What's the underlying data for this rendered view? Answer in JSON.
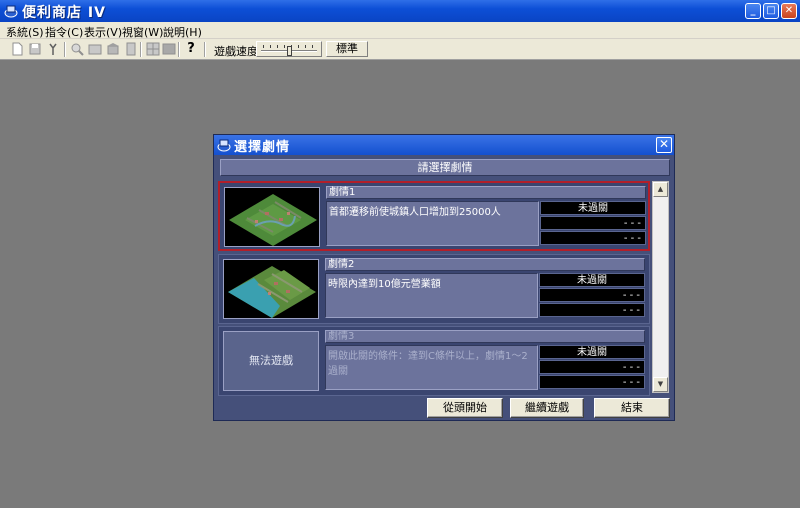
{
  "window": {
    "title": "便利商店 IV",
    "minimize_label": "_",
    "maximize_label": "□",
    "close_label": "✕"
  },
  "menu": [
    "系統(S)",
    "指令(C)",
    "表示(V)",
    "視窗(W)",
    "說明(H)"
  ],
  "toolbar": {
    "help_label": "?",
    "speed_label": "遊戲速度",
    "speed_value": "標準",
    "speed_level": 0.5
  },
  "dialog": {
    "title": "選擇劇情",
    "close_label": "✕",
    "prompt": "請選擇劇情",
    "scenarios": [
      {
        "title": "劇情1",
        "description": "首都遷移前使城鎮人口增加到25000人",
        "status": "未過關",
        "record1": "- - -",
        "record2": "- - -",
        "selected": true
      },
      {
        "title": "劇情2",
        "description": "時限內達到10億元營業額",
        "status": "未過關",
        "record1": "- - -",
        "record2": "- - -",
        "selected": false
      },
      {
        "title": "劇情3",
        "description": "開啟此關的條件：達到C條件以上，劇情1～2過關",
        "status": "未過關",
        "record1": "- - -",
        "record2": "- - -",
        "locked_label": "無法遊戲",
        "selected": false
      }
    ],
    "buttons": {
      "new_game": "從頭開始",
      "continue": "繼續遊戲",
      "exit": "結束"
    }
  },
  "colors": {
    "dialog_bg": "#45507a",
    "selected_border": "#b21f2a",
    "titlebar": "#0d4fd6"
  }
}
